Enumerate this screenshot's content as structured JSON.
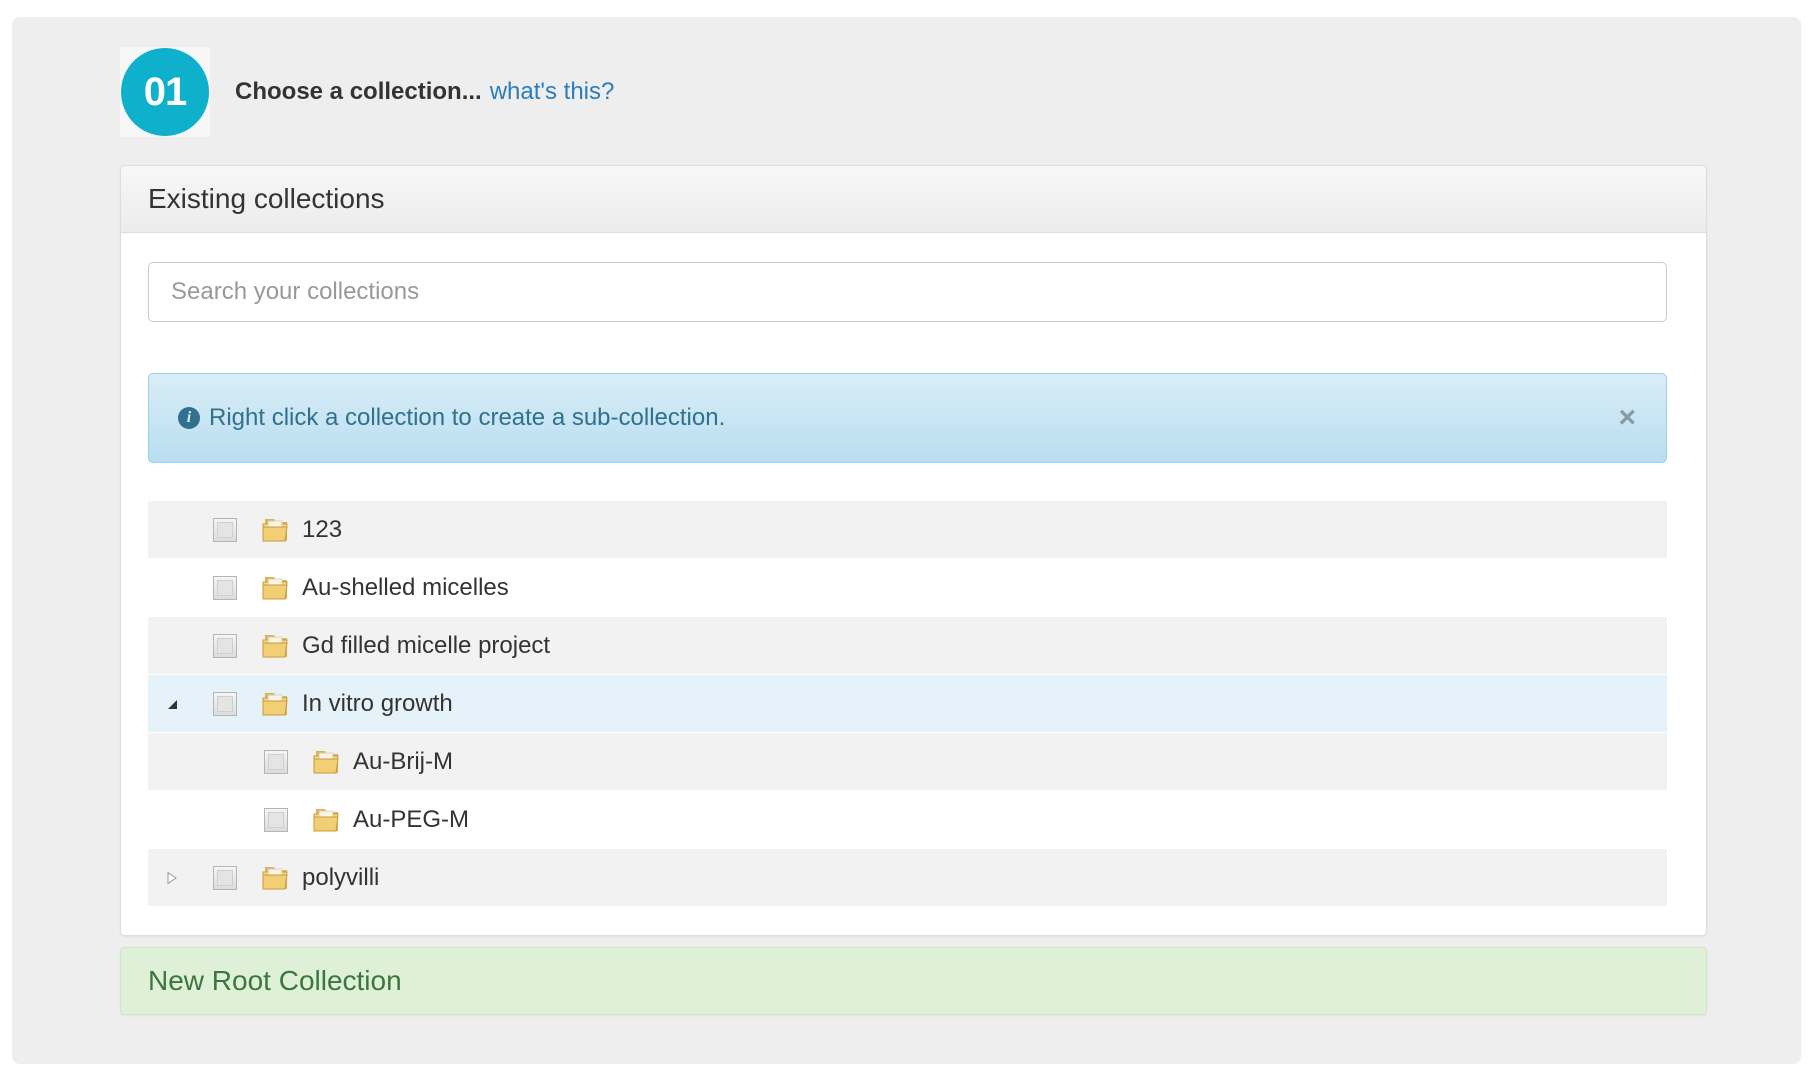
{
  "step": {
    "number": "01",
    "title": "Choose a collection...",
    "help_link": "what's this?",
    "accent_color": "#0fb0cc"
  },
  "panel": {
    "heading": "Existing collections",
    "search_placeholder": "Search your collections",
    "search_value": ""
  },
  "alert": {
    "icon": "info-icon",
    "text": "Right click a collection to create a sub-collection.",
    "close_icon": "close-icon",
    "close_glyph": "×"
  },
  "tree": {
    "rows": [
      {
        "label": "123",
        "level": 0,
        "toggle": "none",
        "checked": false,
        "icon": "folder-icon"
      },
      {
        "label": "Au-shelled micelles",
        "level": 0,
        "toggle": "none",
        "checked": false,
        "icon": "folder-icon"
      },
      {
        "label": "Gd filled micelle project",
        "level": 0,
        "toggle": "none",
        "checked": false,
        "icon": "folder-icon"
      },
      {
        "label": "In vitro growth",
        "level": 0,
        "toggle": "expanded",
        "checked": false,
        "icon": "folder-icon",
        "highlighted": true
      },
      {
        "label": "Au-Brij-M",
        "level": 1,
        "toggle": "none",
        "checked": false,
        "icon": "folder-icon"
      },
      {
        "label": "Au-PEG-M",
        "level": 1,
        "toggle": "none",
        "checked": false,
        "icon": "folder-icon"
      },
      {
        "label": "polyvilli",
        "level": 0,
        "toggle": "collapsed",
        "checked": false,
        "icon": "folder-icon"
      }
    ]
  },
  "new_root": {
    "label": "New Root Collection",
    "color": "#3c763d"
  }
}
